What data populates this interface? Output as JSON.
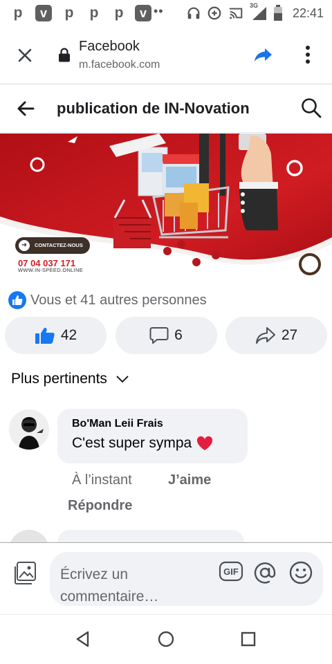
{
  "status_bar": {
    "time": "22:41",
    "network": "3G",
    "app_icons": [
      "p",
      "v",
      "p",
      "p",
      "p",
      "v"
    ]
  },
  "browser": {
    "title": "Facebook",
    "url": "m.facebook.com"
  },
  "page_header": {
    "title": "publication de IN-Novation"
  },
  "post_image": {
    "cta": "CONTACTEZ-NOUS",
    "phone": "07 04 037 171",
    "website": "WWW.IN-SPEED.ONLINE"
  },
  "reactions": {
    "summary": "Vous et 41 autres personnes"
  },
  "actions": {
    "like_count": "42",
    "comment_count": "6",
    "share_count": "27"
  },
  "sort": {
    "label": "Plus pertinents"
  },
  "comment": {
    "author": "Bo'Man Leii Frais",
    "text": "C'est super sympa",
    "emoji": "❤️",
    "time": "À l’instant",
    "like_label": "J’aime",
    "reply_label": "Répondre"
  },
  "composer": {
    "placeholder": "Écrivez un commentaire…",
    "gif_label": "GIF"
  },
  "colors": {
    "facebook_blue": "#1877f2",
    "banner_red": "#c8141c",
    "heart_red": "#e41e3f"
  }
}
